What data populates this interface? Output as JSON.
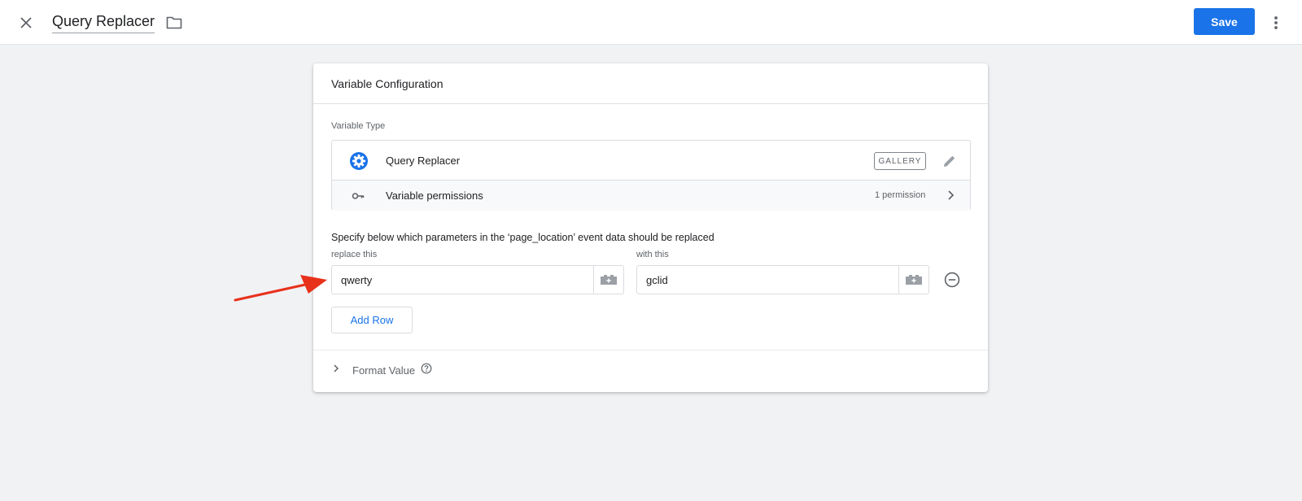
{
  "header": {
    "title": "Query Replacer",
    "save_label": "Save",
    "icons": {
      "close": "close-icon",
      "folder": "folder-icon",
      "more": "more-vert-icon"
    }
  },
  "card": {
    "title": "Variable Configuration",
    "variable_type_label": "Variable Type",
    "type": {
      "name": "Query Replacer",
      "badge": "GALLERY",
      "icon": "gear-icon"
    },
    "permissions": {
      "label": "Variable permissions",
      "count": "1 permission",
      "icon": "key-icon"
    },
    "instructions": "Specify below which parameters in the ‘page_location’ event data should be replaced",
    "rows": [
      {
        "replace_label": "replace this",
        "replace_value": "qwerty",
        "with_label": "with this",
        "with_value": "gclid"
      }
    ],
    "add_row_label": "Add Row",
    "format_value_label": "Format Value"
  },
  "colors": {
    "accent": "#1a73e8",
    "background": "#f1f2f4",
    "annotation_arrow": "#e8311b"
  }
}
